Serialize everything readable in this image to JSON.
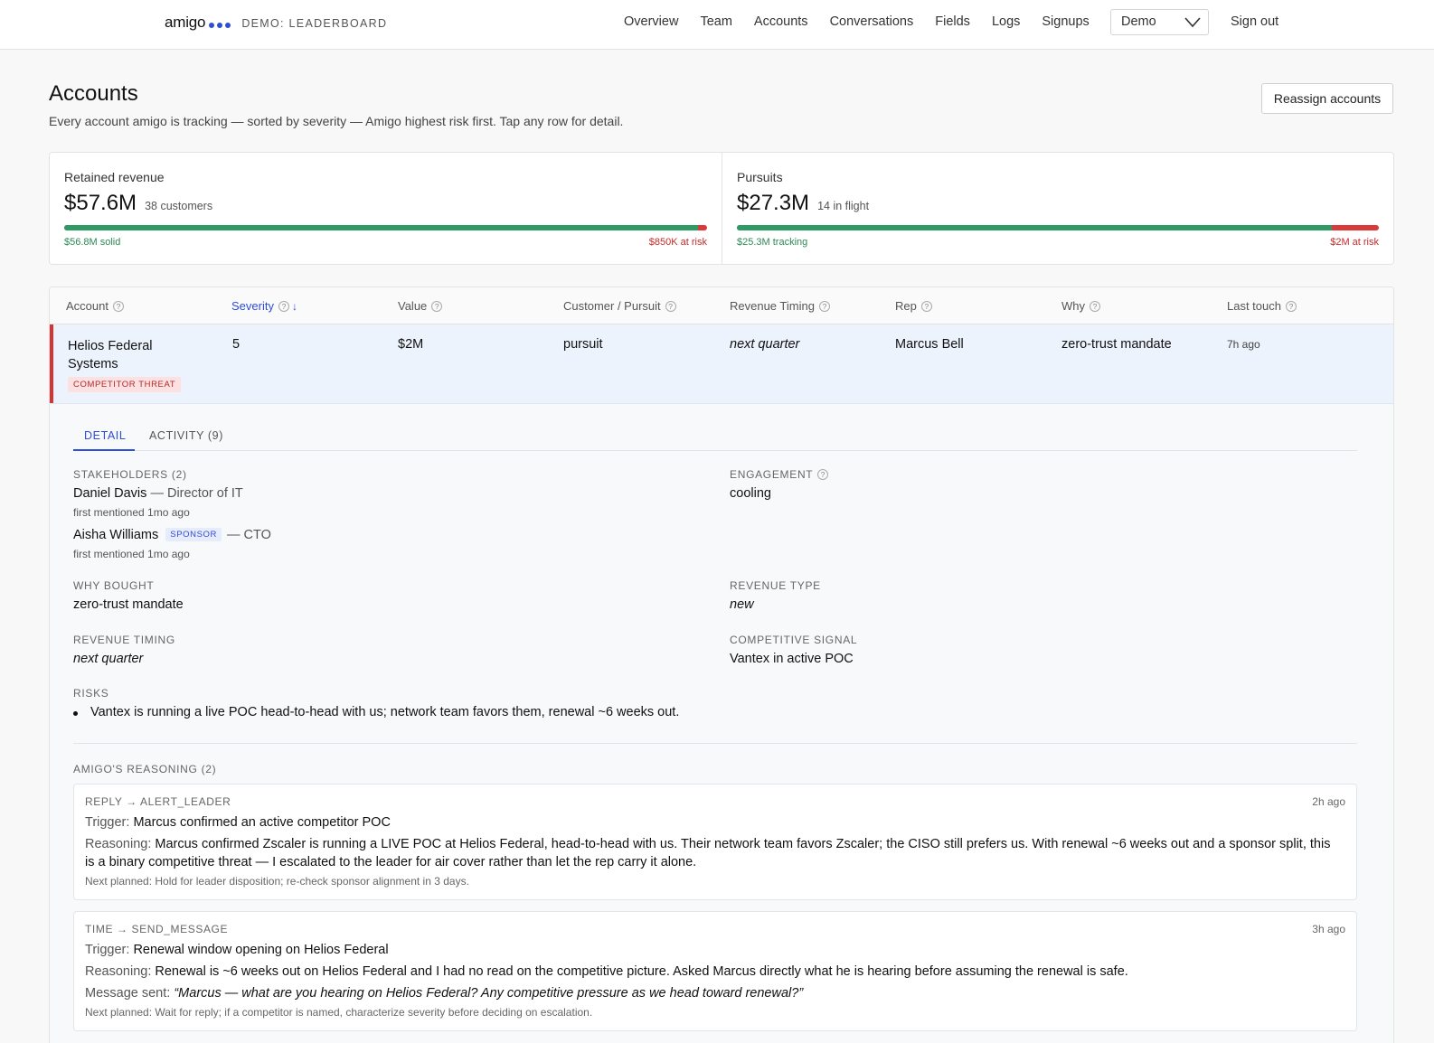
{
  "app": {
    "brand": "amigo",
    "subtitle": "DEMO: LEADERBOARD"
  },
  "nav": {
    "links": [
      "Overview",
      "Team",
      "Accounts",
      "Conversations",
      "Fields",
      "Logs",
      "Signups"
    ],
    "demo_select": "Demo",
    "sign_out": "Sign out"
  },
  "header": {
    "title": "Accounts",
    "subtitle": "Every account amigo is tracking — sorted by severity — Amigo highest risk first. Tap any row for detail.",
    "reassign_label": "Reassign accounts"
  },
  "stats": {
    "retained": {
      "label": "Retained revenue",
      "value": "$57.6M",
      "count": "38 customers",
      "solid_label": "$56.8M solid",
      "risk_label": "$850K at risk",
      "solid_fraction": 0.986
    },
    "pursuits": {
      "label": "Pursuits",
      "value": "$27.3M",
      "count": "14 in flight",
      "solid_label": "$25.3M tracking",
      "risk_label": "$2M at risk",
      "solid_fraction": 0.927
    }
  },
  "table": {
    "columns": [
      "Account",
      "Severity",
      "Value",
      "Customer / Pursuit",
      "Revenue Timing",
      "Rep",
      "Why",
      "Last touch"
    ],
    "sort_column": "Severity",
    "row": {
      "account": "Helios Federal Systems",
      "badge": "COMPETITOR THREAT",
      "severity": "5",
      "value": "$2M",
      "customer_pursuit": "pursuit",
      "revenue_timing": "next quarter",
      "rep": "Marcus Bell",
      "why": "zero-trust mandate",
      "last_touch": "7h ago"
    }
  },
  "detail": {
    "tabs": [
      "DETAIL",
      "ACTIVITY (9)"
    ],
    "stakeholders_label": "STAKEHOLDERS (2)",
    "stakeholders": [
      {
        "name": "Daniel Davis",
        "role": "— Director of IT",
        "mentioned": "first mentioned 1mo ago",
        "badge": ""
      },
      {
        "name": "Aisha Williams",
        "role": "— CTO",
        "mentioned": "first mentioned 1mo ago",
        "badge": "SPONSOR"
      }
    ],
    "engagement_label": "ENGAGEMENT",
    "engagement": "cooling",
    "why_bought_label": "WHY BOUGHT",
    "why_bought": "zero-trust mandate",
    "revenue_type_label": "REVENUE TYPE",
    "revenue_type": "new",
    "revenue_timing_label": "REVENUE TIMING",
    "revenue_timing": "next quarter",
    "competitive_signal_label": "COMPETITIVE SIGNAL",
    "competitive_signal": "Vantex in active POC",
    "risks_label": "RISKS",
    "risks": [
      "Vantex is running a live POC head-to-head with us; network team favors them, renewal ~6 weeks out."
    ],
    "reasoning_label": "AMIGO'S REASONING (2)",
    "reasoning": [
      {
        "type": "REPLY → ALERT_LEADER",
        "time": "2h ago",
        "trigger_label": "Trigger:",
        "trigger": "Marcus confirmed an active competitor POC",
        "reasoning_label": "Reasoning:",
        "reasoning": "Marcus confirmed Zscaler is running a LIVE POC at Helios Federal, head-to-head with us. Their network team favors Zscaler; the CISO still prefers us. With renewal ~6 weeks out and a sponsor split, this is a binary competitive threat — I escalated to the leader for air cover rather than let the rep carry it alone.",
        "next": "Next planned: Hold for leader disposition; re-check sponsor alignment in 3 days."
      },
      {
        "type": "TIME → SEND_MESSAGE",
        "time": "3h ago",
        "trigger_label": "Trigger:",
        "trigger": "Renewal window opening on Helios Federal",
        "reasoning_label": "Reasoning:",
        "reasoning": "Renewal is ~6 weeks out on Helios Federal and I had no read on the competitive picture. Asked Marcus directly what he is hearing before assuming the renewal is safe.",
        "message_label": "Message sent:",
        "message": "“Marcus — what are you hearing on Helios Federal? Any competitive pressure as we head toward renewal?”",
        "next": "Next planned: Wait for reply; if a competitor is named, characterize severity before deciding on escalation."
      }
    ]
  },
  "colors": {
    "accent": "#2d4fd6",
    "solid": "#2f9a64",
    "risk": "#d93a3a",
    "row_highlight": "#edf3fc"
  }
}
